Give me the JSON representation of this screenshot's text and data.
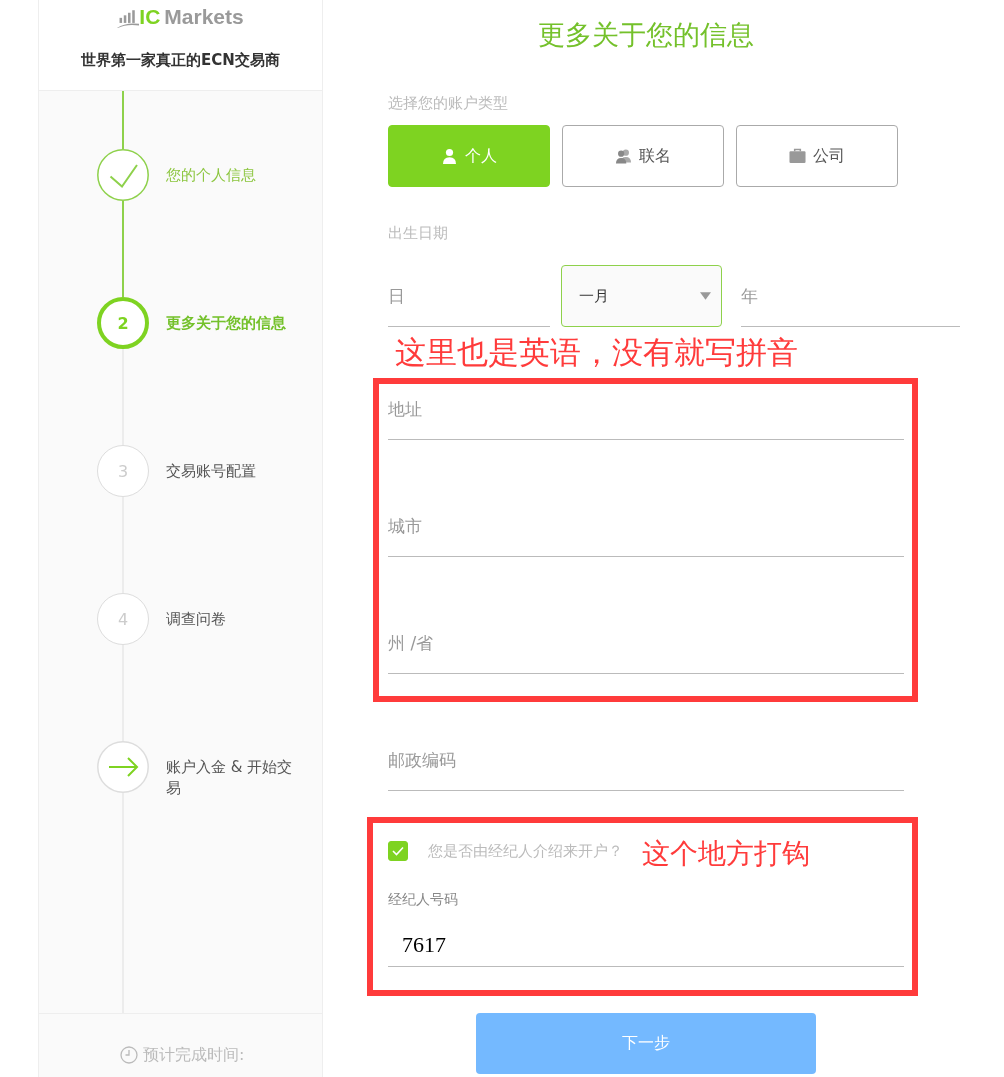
{
  "sidebar": {
    "logo": {
      "accent": "IC",
      "name": "Markets"
    },
    "tagline": "世界第一家真正的ECN交易商",
    "steps": [
      {
        "kind": "check",
        "label": "您的个人信息",
        "completed": true,
        "selected": false
      },
      {
        "kind": "number",
        "number": "2",
        "label": "更多关于您的信息",
        "completed": false,
        "selected": true
      },
      {
        "kind": "number",
        "number": "3",
        "label": "交易账号配置",
        "completed": false,
        "selected": false
      },
      {
        "kind": "number",
        "number": "4",
        "label": "调查问卷",
        "completed": false,
        "selected": false
      },
      {
        "kind": "arrow",
        "label": "账户入金 & 开始交易",
        "completed": false,
        "selected": false
      }
    ],
    "estimate": "预计完成时间:"
  },
  "form": {
    "title": "更多关于您的信息",
    "account_type": {
      "label": "选择您的账户类型",
      "options": [
        {
          "kind": "person",
          "label": "个人",
          "selected": true
        },
        {
          "kind": "group",
          "label": "联名",
          "selected": false
        },
        {
          "kind": "briefcase",
          "label": "公司",
          "selected": false
        }
      ]
    },
    "birth_date": {
      "label": "出生日期",
      "day": {
        "placeholder": "日"
      },
      "month": {
        "value": "一月",
        "focused": true
      },
      "year": {
        "placeholder": "年"
      }
    },
    "address_note": "这里也是英语，没有就写拼音",
    "address_fields": [
      {
        "placeholder": "地址"
      },
      {
        "placeholder": "城市"
      },
      {
        "placeholder": "州 /省"
      }
    ],
    "postal_code": {
      "placeholder": "邮政编码"
    },
    "referral": {
      "question": "您是否由经纪人介绍来开户？",
      "checked": true,
      "note": "这个地方打钩"
    },
    "broker_number": {
      "label": "经纪人号码",
      "value": "7617"
    },
    "next_button": {
      "label": "下一步"
    }
  }
}
